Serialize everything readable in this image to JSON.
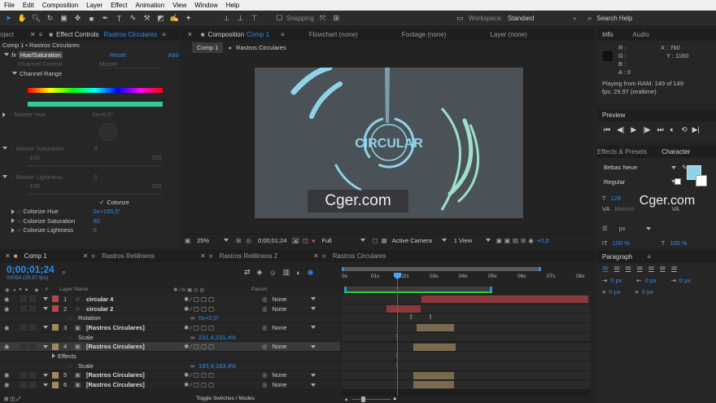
{
  "menu": [
    "File",
    "Edit",
    "Composition",
    "Layer",
    "Effect",
    "Animation",
    "View",
    "Window",
    "Help"
  ],
  "toolbar": {
    "snapping": "Snapping",
    "workspace_label": "Workspace:",
    "workspace_value": "Standard",
    "search_placeholder": "Search Help"
  },
  "project_tab": "oject",
  "effect_controls": {
    "tab": "Effect Controls",
    "comp_name": "Rastros Circulares",
    "breadcrumb": "Comp 1 • Rastros Circulares",
    "effect": "Hue/Saturation",
    "reset": "Reset",
    "about": "Abo",
    "channel_control_label": "Channel Control",
    "channel_control_value": "Master",
    "channel_range": "Channel Range",
    "master_hue": "Master Hue",
    "master_hue_val": "0x+0,0°",
    "master_sat": "Master Saturation",
    "master_sat_val": "0",
    "min": "-100",
    "max": "100",
    "master_light": "Master Lightness",
    "master_light_val": "0",
    "colorize": "Colorize",
    "colorize_hue": "Colorize Hue",
    "colorize_hue_val": "0x+165,0°",
    "colorize_sat": "Colorize Saturation",
    "colorize_sat_val": "60",
    "colorize_light": "Colorize Lightness",
    "colorize_light_val": "0"
  },
  "composition": {
    "tab": "Composition",
    "comp": "Comp 1",
    "flowchart": "Flowchart (none)",
    "footage": "Footage (none)",
    "layer": "Layer (none)",
    "sub_tab": "Comp 1",
    "breadcrumb": "Rastros Circulares",
    "logo_text": "CIRCULAR",
    "watermark": "Cger.com",
    "zoom": "25%",
    "timecode": "0;00;01;24",
    "resolution": "Full",
    "camera": "Active Camera",
    "view": "1 View",
    "exposure": "+0,0"
  },
  "info": {
    "tab": "Info",
    "audio_tab": "Audio",
    "r": "R :",
    "g": "G :",
    "b": "B :",
    "a": "A :  0",
    "x": "X : 760",
    "y": "Y : 1160",
    "playing": "Playing from RAM: 149 of 149",
    "fps": "fps: 29,97 (realtime)"
  },
  "preview": {
    "tab": "Preview"
  },
  "effects_presets": {
    "tab": "Effects & Presets",
    "character_tab": "Character",
    "font": "Bebas Neue",
    "style": "Regular",
    "watermark": "Cger.com",
    "size_value": "128",
    "metrics": "Metrics",
    "va": "VA",
    "px": "px",
    "pct1": "100 %",
    "pct2": "100 %"
  },
  "paragraph": {
    "tab": "Paragraph",
    "val1": "0 px",
    "val2": "0 px",
    "val3": "0 px",
    "val4": "0 px",
    "val5": "0 px"
  },
  "timeline": {
    "tabs": [
      "Comp 1",
      "Rastros Retilineos",
      "Rastros Retilineos 2",
      "Rastros Circulares"
    ],
    "timecode": "0;00;01;24",
    "frames": "00054 (29.97 fps)",
    "layer_name_header": "Layer Name",
    "parent_header": "Parent",
    "rulers": [
      "0s",
      "01s",
      "02s",
      "03s",
      "04s",
      "05s",
      "06s",
      "07s",
      "08s"
    ],
    "footer": "Toggle Switches / Modes",
    "layers": [
      {
        "num": "1",
        "name": "circular 4",
        "parent": "None",
        "color": "#b04848",
        "type": "layer"
      },
      {
        "num": "2",
        "name": "circular 2",
        "parent": "None",
        "color": "#b04848",
        "type": "layer"
      },
      {
        "num": "",
        "name": "Rotation",
        "value": "0x+0,0°",
        "type": "prop"
      },
      {
        "num": "3",
        "name": "[Rastros Circulares]",
        "parent": "None",
        "color": "#a08a60",
        "type": "layer"
      },
      {
        "num": "",
        "name": "Scale",
        "value": "231,4,231,4%",
        "type": "prop"
      },
      {
        "num": "4",
        "name": "[Rastros Circulares]",
        "parent": "None",
        "color": "#a08a60",
        "type": "layer"
      },
      {
        "num": "",
        "name": "Effects",
        "type": "group"
      },
      {
        "num": "",
        "name": "Scale",
        "value": "183,4,183,4%",
        "type": "prop"
      },
      {
        "num": "5",
        "name": "[Rastros Circulares]",
        "parent": "None",
        "color": "#a08a60",
        "type": "layer"
      },
      {
        "num": "6",
        "name": "[Rastros Circulares]",
        "parent": "None",
        "color": "#a08a60",
        "type": "layer"
      }
    ]
  },
  "colors": {
    "accent": "#2d8ceb",
    "circle": "#8fd3e8",
    "mint": "#9ee0c8"
  }
}
